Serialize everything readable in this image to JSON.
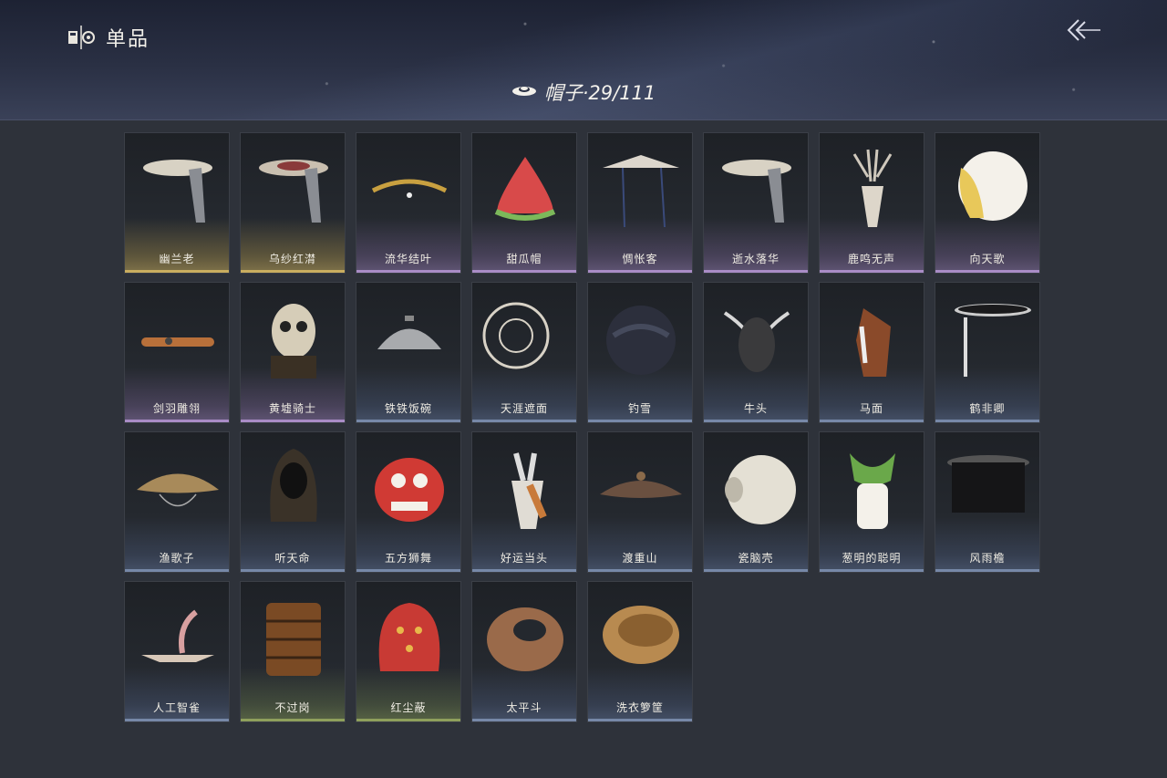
{
  "header": {
    "title": "单品",
    "title_icon": "collection-icon",
    "back_icon": "back-arrow-icon"
  },
  "category": {
    "label": "帽子·29/111",
    "icon": "hat-icon"
  },
  "colors": {
    "gold": "#c9ad5f",
    "purple": "#a98cc6",
    "blue": "#7788a8",
    "green": "#8fa05c"
  },
  "items": [
    {
      "name": "幽兰老",
      "tier": "gold",
      "icon": "veiled-straw-hat-icon"
    },
    {
      "name": "乌纱红潸",
      "tier": "gold",
      "icon": "veiled-red-hat-icon"
    },
    {
      "name": "流华结叶",
      "tier": "purple",
      "icon": "laurel-wreath-icon"
    },
    {
      "name": "甜瓜帽",
      "tier": "purple",
      "icon": "watermelon-hat-icon"
    },
    {
      "name": "惆怅客",
      "tier": "purple",
      "icon": "wide-brim-hat-icon"
    },
    {
      "name": "逝水落华",
      "tier": "purple",
      "icon": "veiled-straw-hat-icon"
    },
    {
      "name": "鹿鸣无声",
      "tier": "purple",
      "icon": "deer-skull-icon"
    },
    {
      "name": "向天歌",
      "tier": "purple",
      "icon": "goose-head-icon"
    },
    {
      "name": "剑羽雕翎",
      "tier": "purple",
      "icon": "headband-icon"
    },
    {
      "name": "黄墟骑士",
      "tier": "purple",
      "icon": "skull-mask-icon"
    },
    {
      "name": "铁铁饭碗",
      "tier": "blue",
      "icon": "iron-bowl-icon"
    },
    {
      "name": "天涯遮面",
      "tier": "blue",
      "icon": "woven-veil-icon"
    },
    {
      "name": "钓雪",
      "tier": "blue",
      "icon": "dark-straw-hat-icon"
    },
    {
      "name": "牛头",
      "tier": "blue",
      "icon": "ox-head-icon"
    },
    {
      "name": "马面",
      "tier": "blue",
      "icon": "horse-head-icon"
    },
    {
      "name": "鹤非卿",
      "tier": "blue",
      "icon": "flat-hat-icon"
    },
    {
      "name": "渔歌子",
      "tier": "blue",
      "icon": "fisher-hat-icon"
    },
    {
      "name": "听天命",
      "tier": "blue",
      "icon": "hood-icon"
    },
    {
      "name": "五方狮舞",
      "tier": "blue",
      "icon": "lion-dance-icon"
    },
    {
      "name": "好运当头",
      "tier": "blue",
      "icon": "donkey-head-icon"
    },
    {
      "name": "渡重山",
      "tier": "blue",
      "icon": "bamboo-hat-icon"
    },
    {
      "name": "瓷脑壳",
      "tier": "blue",
      "icon": "porcelain-jar-icon"
    },
    {
      "name": "葱明的聪明",
      "tier": "blue",
      "icon": "scallion-hat-icon"
    },
    {
      "name": "风雨檐",
      "tier": "blue",
      "icon": "curtain-hat-icon"
    },
    {
      "name": "人工智雀",
      "tier": "blue",
      "icon": "paper-bird-icon"
    },
    {
      "name": "不过岗",
      "tier": "green",
      "icon": "stacked-bowls-icon"
    },
    {
      "name": "红尘蔽",
      "tier": "green",
      "icon": "red-cap-icon"
    },
    {
      "name": "太平斗",
      "tier": "blue",
      "icon": "woven-basket-icon"
    },
    {
      "name": "洗衣箩筐",
      "tier": "blue",
      "icon": "laundry-basket-icon"
    }
  ]
}
